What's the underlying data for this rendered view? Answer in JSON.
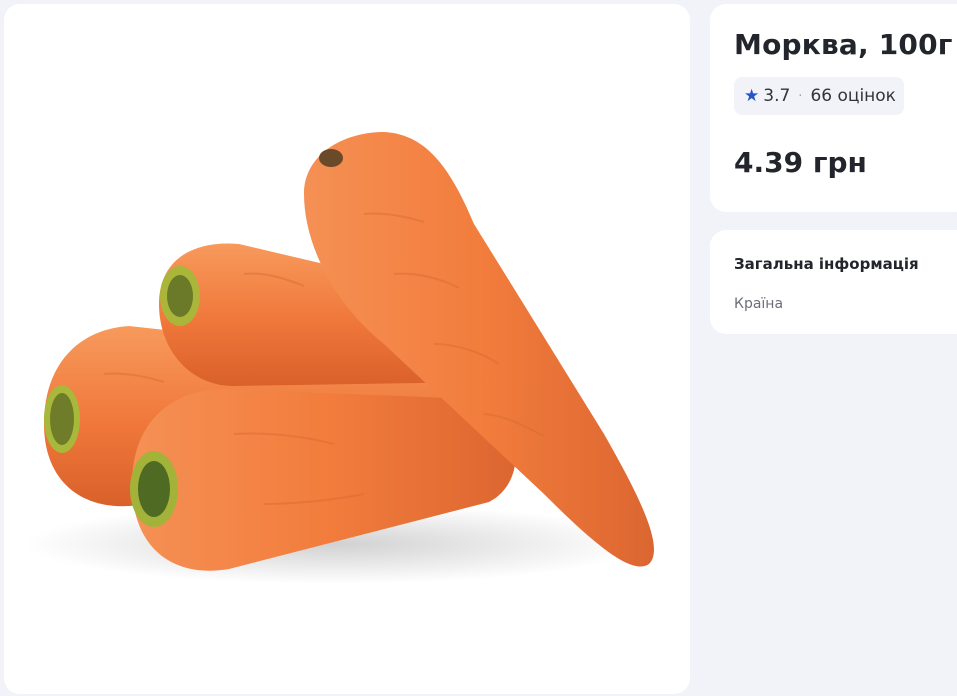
{
  "product": {
    "title": "Морква, 100г",
    "rating": {
      "icon": "star-icon",
      "value": "3.7",
      "separator": "·",
      "count_label": "66 оцінок"
    },
    "price": "4.39 грн",
    "image_alt": "carrots"
  },
  "general_info": {
    "heading": "Загальна інформація",
    "rows": [
      {
        "label": "Країна"
      }
    ]
  },
  "colors": {
    "accent": "#2754ca",
    "background": "#f1f3f9",
    "card": "#ffffff",
    "carrot": "#f17e3c"
  }
}
